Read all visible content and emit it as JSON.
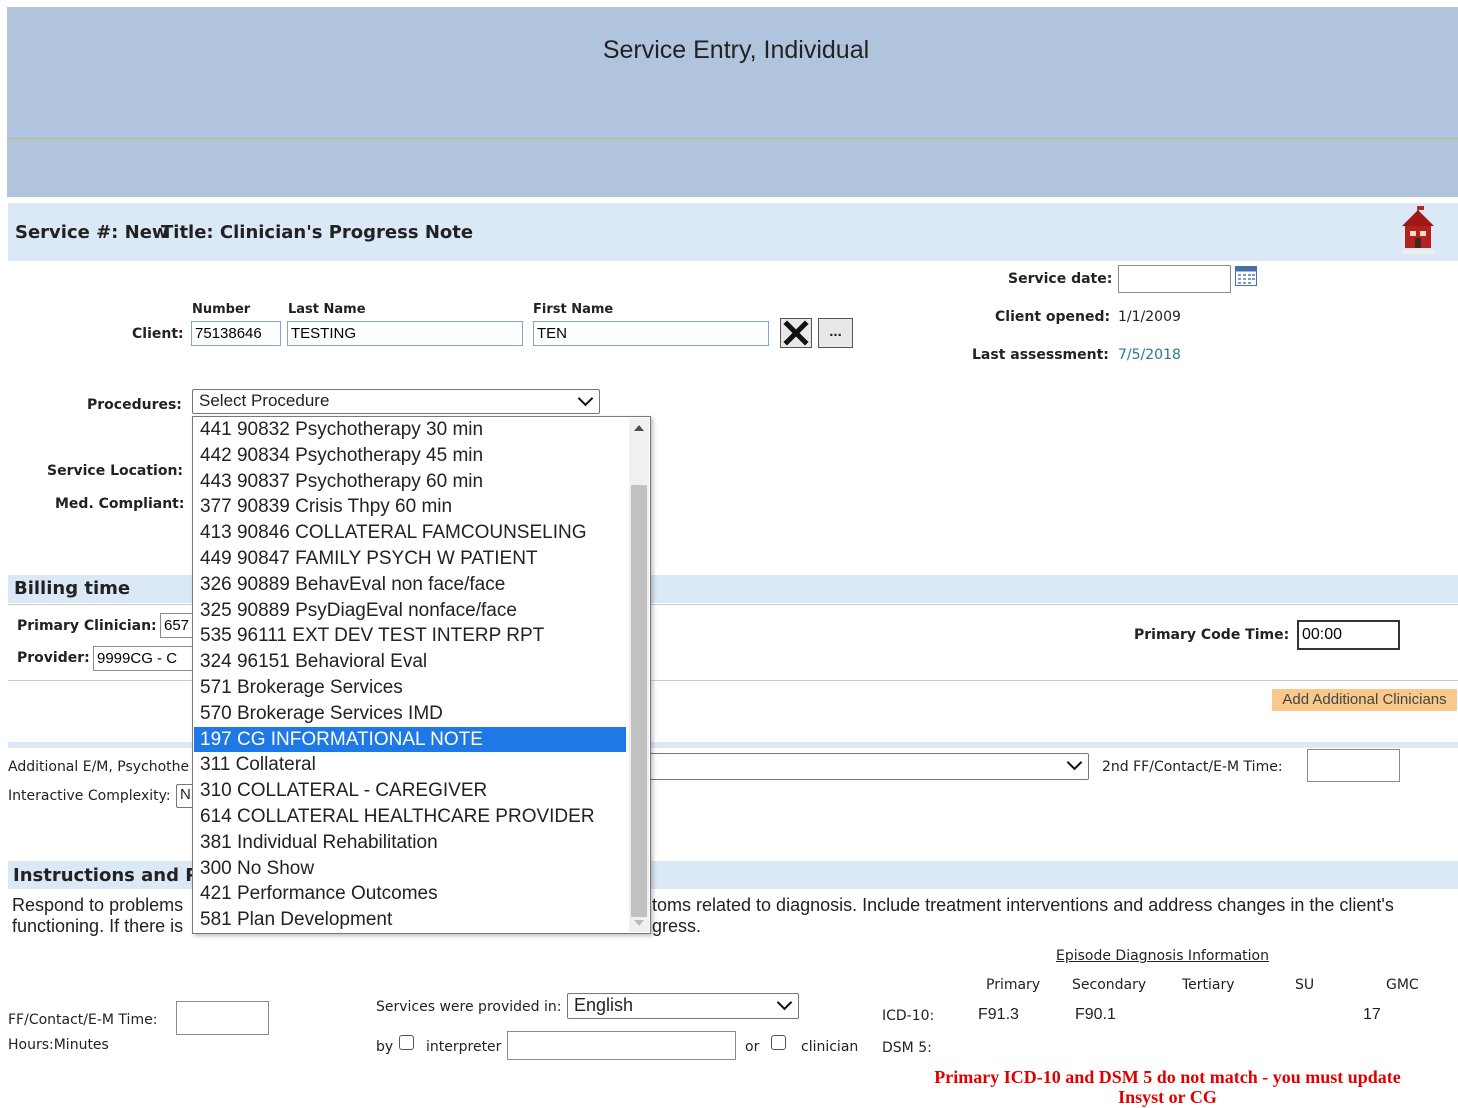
{
  "header": {
    "title": "Service Entry, Individual"
  },
  "service_bar": {
    "service_label": "Service #: New",
    "title_label": "Title: Clinician's Progress Note",
    "logo": "school-house-icon"
  },
  "service_date": {
    "label": "Service date:",
    "value": ""
  },
  "client_opened": {
    "label": "Client opened:",
    "value": "1/1/2009"
  },
  "last_assessment": {
    "label": "Last assessment:",
    "value": "7/5/2018"
  },
  "client": {
    "label": "Client:",
    "number_header": "Number",
    "last_header": "Last Name",
    "first_header": "First Name",
    "number": "75138646",
    "last_name": "TESTING",
    "first_name": "TEN",
    "clear_icon": "close-x-icon",
    "lookup_label": "..."
  },
  "procedures": {
    "label": "Procedures:",
    "selected": "Select Procedure",
    "options": [
      "441 90832 Psychotherapy 30 min",
      "442 90834 Psychotherapy 45 min",
      "443 90837 Psychotherapy 60 min",
      "377 90839 Crisis Thpy 60 min",
      "413 90846 COLLATERAL FAMCOUNSELING",
      "449 90847 FAMILY PSYCH W PATIENT",
      "326 90889 BehavEval non face/face",
      "325 90889 PsyDiagEval nonface/face",
      "535 96111 EXT DEV TEST INTERP RPT",
      "324 96151 Behavioral Eval",
      "571 Brokerage Services",
      "570 Brokerage Services IMD",
      "197 CG INFORMATIONAL NOTE",
      "311 Collateral",
      "310 COLLATERAL - CAREGIVER",
      "614 COLLATERAL HEALTHCARE PROVIDER",
      "381 Individual Rehabilitation",
      "300 No Show",
      "421 Performance Outcomes",
      "581 Plan Development"
    ],
    "highlighted_index": 12
  },
  "service_location": {
    "label": "Service Location:"
  },
  "med_compliant": {
    "label": "Med. Compliant:"
  },
  "billing": {
    "title": "Billing time",
    "primary_clinician_label": "Primary Clinician:",
    "primary_clinician_value": "657",
    "provider_label": "Provider:",
    "provider_value": "9999CG - C",
    "primary_code_time_label": "Primary Code Time:",
    "primary_code_time_value": "00:00",
    "add_clinicians_label": "Add Additional Clinicians"
  },
  "additional": {
    "em_label": "Additional E/M, Psychothe",
    "interactive_label": "Interactive Complexity:",
    "interactive_value": "N",
    "second_time_label": "2nd FF/Contact/E-M Time:",
    "second_time_value": ""
  },
  "instructions": {
    "title": "Instructions and P",
    "line1_left": "Respond to problems",
    "line1_right": "toms related to diagnosis. Include treatment interventions and address changes in the client's",
    "line2_left": "functioning. If there is",
    "line2_right": "gress."
  },
  "time_entry": {
    "ff_label": "FF/Contact/E-M Time:",
    "ff_value": "",
    "hours_label": "Hours:Minutes",
    "provided_in_label": "Services were provided in:",
    "language": "English",
    "by_label": "by",
    "interpreter_label": "interpreter",
    "interpreter_value": "",
    "or_label": "or",
    "clinician_label": "clinician"
  },
  "diagnosis": {
    "title": "Episode Diagnosis Information",
    "headers": [
      "Primary",
      "Secondary",
      "Tertiary",
      "SU",
      "GMC"
    ],
    "icd_label": "ICD-10:",
    "icd_primary": "F91.3",
    "icd_secondary": "F90.1",
    "icd_gmc": "17",
    "dsm_label": "DSM 5:",
    "warning_line1": "Primary ICD-10 and DSM 5 do not match - you must update",
    "warning_line2": "Insyst or CG"
  },
  "colors": {
    "header_bg": "#b0c4de",
    "band_bg": "#dbe8f5",
    "highlight": "#1e78e6",
    "warning": "#e00000",
    "link_teal": "#2b7a8a"
  }
}
